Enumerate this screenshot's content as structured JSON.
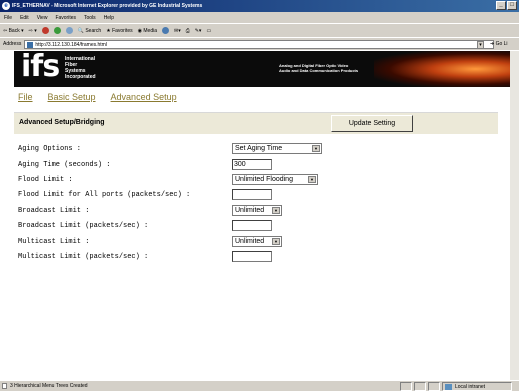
{
  "window": {
    "title": "IFS_ETHERNAV - Microsoft Internet Explorer provided by GE Industrial Systems"
  },
  "menubar": [
    "File",
    "Edit",
    "View",
    "Favorites",
    "Tools",
    "Help"
  ],
  "toolbar": {
    "back": "Back",
    "search": "Search",
    "favorites": "Favorites",
    "media": "Media"
  },
  "addressbar": {
    "label": "Address",
    "url": "http://3.112.130.184/frames.html",
    "go": "Go",
    "links": "Li"
  },
  "banner": {
    "logo": "ifs",
    "company_lines": [
      "International",
      "Fiber",
      "Systems",
      "Incorporated"
    ],
    "tagline_lines": [
      "Analog and Digital Fiber Optic Video",
      "Audio and Data Communication Products"
    ]
  },
  "nav": {
    "file": "File",
    "basic": "Basic Setup",
    "advanced": "Advanced Setup"
  },
  "section": {
    "title": "Advanced Setup/Bridging",
    "update_button": "Update Setting"
  },
  "form": {
    "aging_options_label": "Aging Options :",
    "aging_options_value": "Set Aging Time",
    "aging_time_label": "Aging Time (seconds) :",
    "aging_time_value": "300",
    "flood_limit_label": "Flood Limit :",
    "flood_limit_value": "Unlimited Flooding",
    "flood_all_label": "Flood Limit for All ports (packets/sec) :",
    "flood_all_value": "",
    "broadcast_limit_label": "Broadcast Limit :",
    "broadcast_limit_value": "Unlimited",
    "broadcast_pps_label": "Broadcast Limit (packets/sec) :",
    "broadcast_pps_value": "",
    "multicast_limit_label": "Multicast Limit :",
    "multicast_limit_value": "Unlimited",
    "multicast_pps_label": "Multicast Limit (packets/sec) :",
    "multicast_pps_value": ""
  },
  "statusbar": {
    "text": "3 Hierarchical Menu Trees Created",
    "zone": "Local intranet"
  }
}
